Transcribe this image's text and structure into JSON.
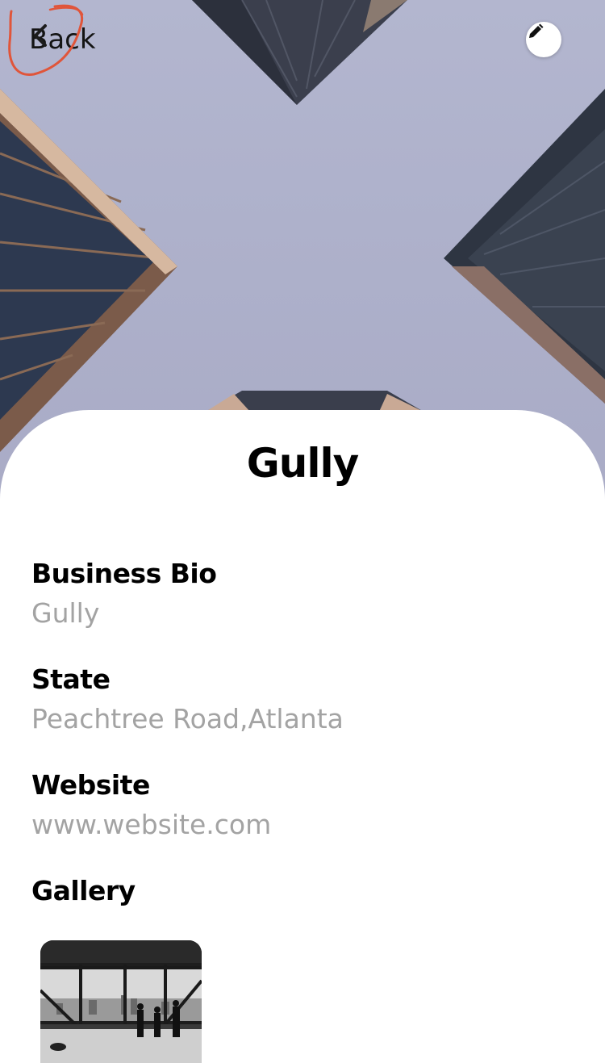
{
  "header": {
    "back_label": "Back"
  },
  "profile": {
    "name": "Gully"
  },
  "fields": [
    {
      "label": "Business Bio",
      "value": "Gully"
    },
    {
      "label": "State",
      "value": "Peachtree Road,Atlanta"
    },
    {
      "label": "Website",
      "value": "www.website.com"
    }
  ],
  "gallery": {
    "label": "Gallery"
  },
  "icons": {
    "back": "chevron-left-icon",
    "edit": "pencil-icon"
  },
  "colors": {
    "sky": "#b0b3cc",
    "annotation": "#e0553a",
    "value_text": "#a3a3a3"
  }
}
